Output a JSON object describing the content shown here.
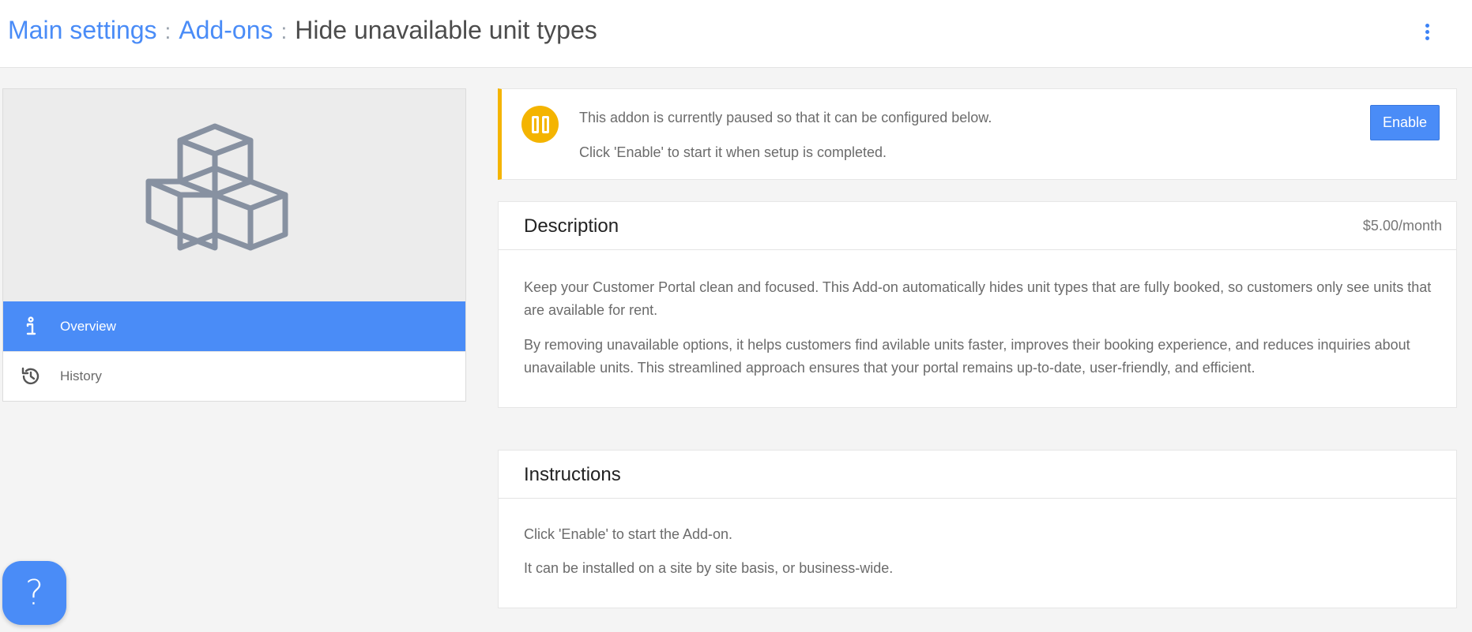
{
  "breadcrumb": {
    "main_settings": "Main settings",
    "separator": ":",
    "addons": "Add-ons",
    "current": "Hide unavailable unit types"
  },
  "menu_icon": "kebab-vertical-icon",
  "hero_icon": "stacked-cubes-icon",
  "nav": {
    "items": [
      {
        "label": "Overview",
        "icon": "info-icon",
        "active": true
      },
      {
        "label": "History",
        "icon": "history-icon",
        "active": false
      }
    ]
  },
  "alert": {
    "icon": "pause-icon",
    "line1": "This addon is currently paused so that it can be configured below.",
    "line2": "Click 'Enable' to start it when setup is completed.",
    "enable_label": "Enable"
  },
  "description": {
    "title": "Description",
    "price": "$5.00/month",
    "paragraphs": [
      "Keep your Customer Portal clean and focused. This Add-on automatically hides unit types that are fully booked, so customers only see units that are available for rent.",
      "By removing unavailable options, it helps customers find avilable units faster, improves their booking experience, and reduces inquiries about unavailable units. This streamlined approach ensures that your portal remains up-to-date, user-friendly, and efficient."
    ]
  },
  "instructions": {
    "title": "Instructions",
    "paragraphs": [
      "Click 'Enable' to start the Add-on.",
      "It can be installed on a site by site basis, or business-wide."
    ]
  },
  "help": {
    "label": "?"
  },
  "colors": {
    "accent": "#4a8cf7",
    "warning": "#f4b400",
    "background": "#f4f4f4"
  }
}
